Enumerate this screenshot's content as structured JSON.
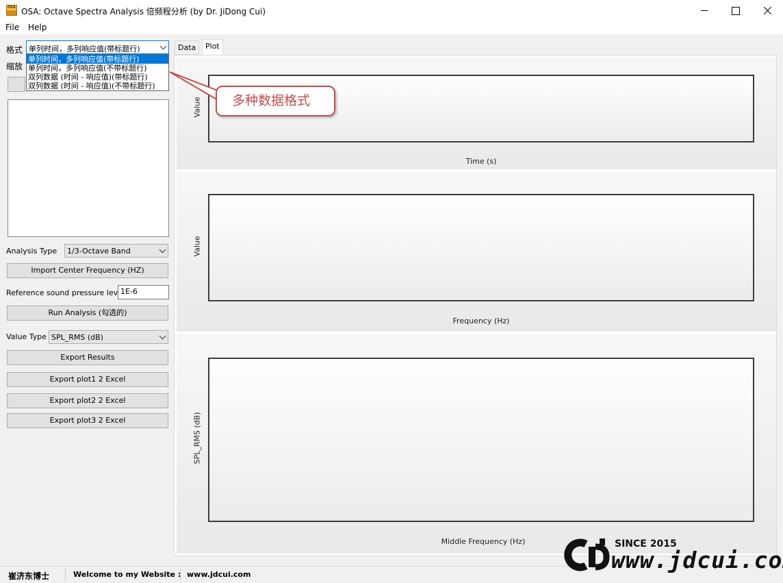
{
  "window": {
    "title": "OSA: Octave Spectra Analysis 倍频程分析 (by Dr. JiDong Cui)",
    "icon_label": "OSA"
  },
  "menu": [
    "File",
    "Help"
  ],
  "left": {
    "format_label": "格式",
    "format_value": "单列时间，多列响应值(带标题行)",
    "format_options": [
      "单列时间，多列响应值(带标题行)",
      "单列时间，多列响应值(不带标题行)",
      "双列数据 (时间 - 响应值)(带标题行)",
      "双列数据 (时间 - 响应值)(不带标题行)"
    ],
    "scale_label": "缩放",
    "analysis_type_label": "Analysis Type",
    "analysis_type_value": "1/3-Octave Band",
    "import_center_freq": "Import Center Frequency (HZ)",
    "ref_spl_label": "Reference sound pressure level",
    "ref_spl_value": "1E-6",
    "run_analysis": "Run Analysis (勾选的)",
    "value_type_label": "Value Type",
    "value_type_value": "SPL_RMS (dB)",
    "export_results": "Export Results",
    "export_plot1": "Export plot1 2 Excel",
    "export_plot2": "Export plot2 2 Excel",
    "export_plot3": "Export plot3 2 Excel"
  },
  "tabs": [
    "Data",
    "Plot"
  ],
  "plots": [
    {
      "ylabel": "Value",
      "xlabel": "Time (s)"
    },
    {
      "ylabel": "Value",
      "xlabel": "Frequency (Hz)"
    },
    {
      "ylabel": "SPL_RMS (dB)",
      "xlabel": "Middle Frequency (Hz)"
    }
  ],
  "callout": "多种数据格式",
  "status": {
    "author": "崔济东博士",
    "welcome": "Welcome to my Website :",
    "site": "www.jdcui.com"
  },
  "watermark": {
    "since": "SINCE 2015",
    "url": "www.jdcui.com"
  },
  "colors": {
    "accent": "#0078d7",
    "callout": "#c0504d",
    "plot_border": "#3c3c3c"
  }
}
